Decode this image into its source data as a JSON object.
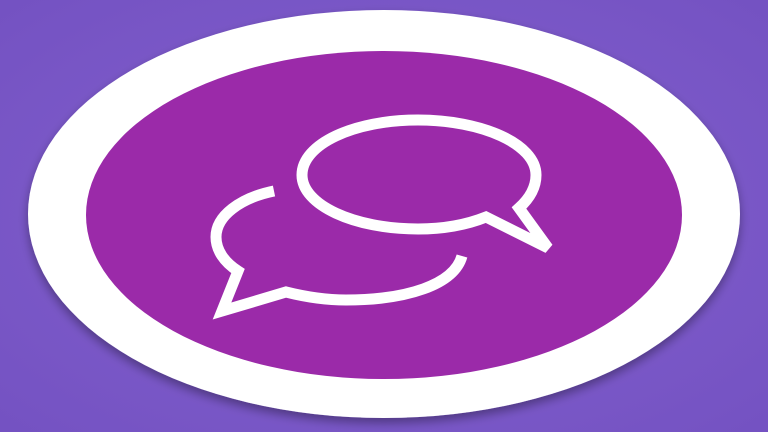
{
  "logo": {
    "icon": "chat-bubbles-icon",
    "colors": {
      "background": "#7a57c7",
      "outer_ring": "#ffffff",
      "inner_disc": "#9b2aa9",
      "bubble_stroke": "#ffffff"
    }
  }
}
